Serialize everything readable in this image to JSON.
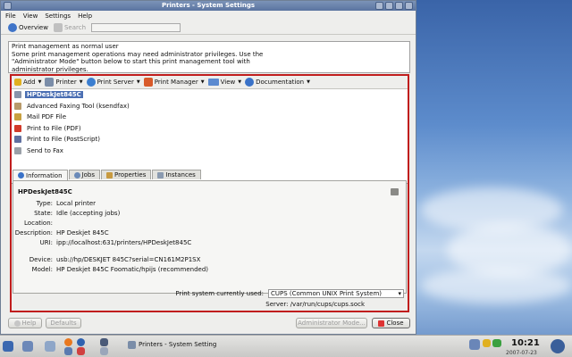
{
  "window": {
    "title": "Printers - System Settings"
  },
  "menu": [
    "File",
    "View",
    "Settings",
    "Help"
  ],
  "toolbar": {
    "overview": "Overview",
    "search": "Search"
  },
  "info_text": [
    "Print management as normal user",
    "Some print management operations may need administrator privileges. Use the",
    "\"Administrator Mode\" button below to start this print management tool with",
    "administrator privileges."
  ],
  "printer_toolbar": {
    "add": "Add",
    "printer": "Printer",
    "print_server": "Print Server",
    "print_manager": "Print Manager",
    "view": "View",
    "documentation": "Documentation"
  },
  "printers": [
    {
      "label": "HPDeskJet845C",
      "selected": true
    },
    {
      "label": "Advanced Faxing Tool (ksendfax)"
    },
    {
      "label": "Mail PDF File"
    },
    {
      "label": "Print to File (PDF)"
    },
    {
      "label": "Print to File (PostScript)"
    },
    {
      "label": "Send to Fax"
    }
  ],
  "tabs": [
    "Information",
    "Jobs",
    "Properties",
    "Instances"
  ],
  "details": {
    "title": "HPDeskJet845C",
    "rows": [
      {
        "key": "Type:",
        "value": "Local printer"
      },
      {
        "key": "State:",
        "value": "Idle (accepting jobs)"
      },
      {
        "key": "Location:",
        "value": ""
      },
      {
        "key": "Description:",
        "value": "HP Deskjet 845C"
      },
      {
        "key": "URI:",
        "value": "ipp://localhost:631/printers/HPDeskJet845C"
      },
      {
        "key": "Device:",
        "value": "usb://hp/DESKJET 845C?serial=CN161M2P1SX"
      },
      {
        "key": "Model:",
        "value": "HP Deskjet 845C Foomatic/hpijs (recommended)"
      }
    ]
  },
  "print_system": {
    "label": "Print system currently used:",
    "value": "CUPS (Common UNIX Print System)",
    "server": "Server: /var/run/cups/cups.sock"
  },
  "buttons": {
    "help": "Help",
    "defaults": "Defaults",
    "admin_mode": "Administrator Mode...",
    "close": "Close"
  },
  "taskbar": {
    "task_title": "Printers - System Setting",
    "clock": "10:21",
    "date": "2007-07-23"
  }
}
